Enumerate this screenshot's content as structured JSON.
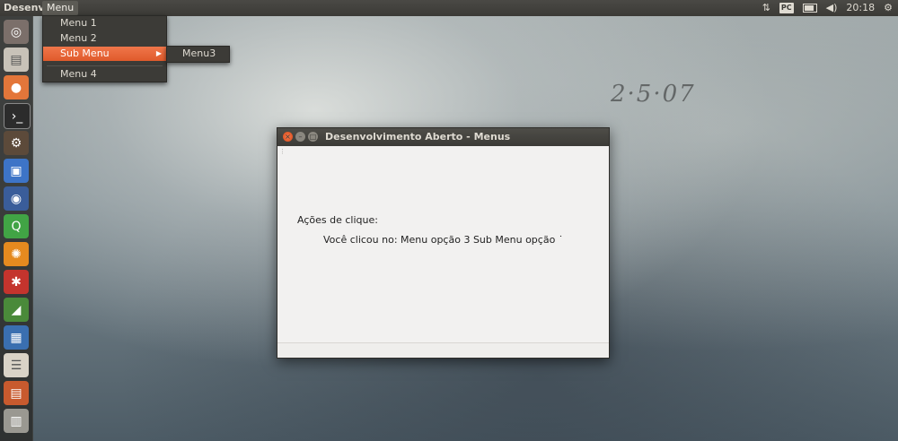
{
  "desktop": {
    "wallpaper_mark": "2·5·07"
  },
  "top_panel": {
    "app_name": "Desenv",
    "menu_label": "Menu",
    "indicators": {
      "network": "⇅",
      "keyboard": "PC",
      "volume": "◀)",
      "clock": "20:18",
      "settings": "⚙"
    }
  },
  "launcher": {
    "icons": [
      "ubuntu-dash-icon",
      "files-icon",
      "firefox-icon",
      "terminal-icon",
      "settings-gear-icon",
      "sdk-icon",
      "eclipse-icon",
      "qt-creator-icon",
      "system-settings-icon",
      "network-icon",
      "spreadsheet-icon",
      "app-icon",
      "app-icon",
      "app-icon",
      "trash-icon"
    ]
  },
  "dropdown": {
    "items": [
      {
        "label": "Menu 1"
      },
      {
        "label": "Menu 2"
      },
      {
        "label": "Sub Menu",
        "arrow": "▶"
      },
      {
        "label": "Menu 4"
      }
    ],
    "submenu": {
      "label": "Menu3"
    }
  },
  "window": {
    "title": "Desenvolvimento Aberto - Menus",
    "label_actions": "Ações de clique:",
    "label_result": "Você clicou no: Menu opção 3 Sub Menu opção ˙"
  },
  "colors": {
    "accent": "#e05a2b",
    "panel": "#3c3b37",
    "window_bg": "#f2f1f0"
  }
}
